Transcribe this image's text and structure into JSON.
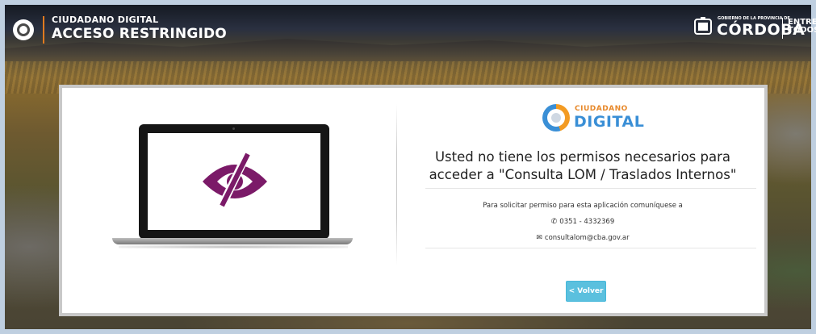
{
  "header": {
    "subtitle": "CIUDADANO DIGITAL",
    "title": "ACCESO RESTRINGIDO",
    "gov_small": "GOBIERNO DE LA PROVINCIA DE",
    "gov_name": "CÓRDOBA",
    "entre_line1": "ENTRE",
    "entre_line2": "TODOS",
    "accent_color": "#e07a1f"
  },
  "brand": {
    "small": "CIUDADANO",
    "big": "DIGITAL",
    "orange": "#e7882a",
    "blue": "#3a8fd6"
  },
  "main": {
    "message_line1": "Usted no tiene los permisos necesarios para",
    "message_line2": "acceder a \"Consulta LOM / Traslados Internos\"",
    "request_text": "Para solicitar permiso para esta aplicación comuníquese a",
    "phone": "0351 - 4332369",
    "email": "consultalom@cba.gov.ar",
    "back_button": "< Volver",
    "icons": {
      "phone": "phone-icon",
      "email": "envelope-icon",
      "hidden": "eye-slash-icon"
    },
    "icon_color": "#7b1a68",
    "button_color": "#5bc0de"
  }
}
